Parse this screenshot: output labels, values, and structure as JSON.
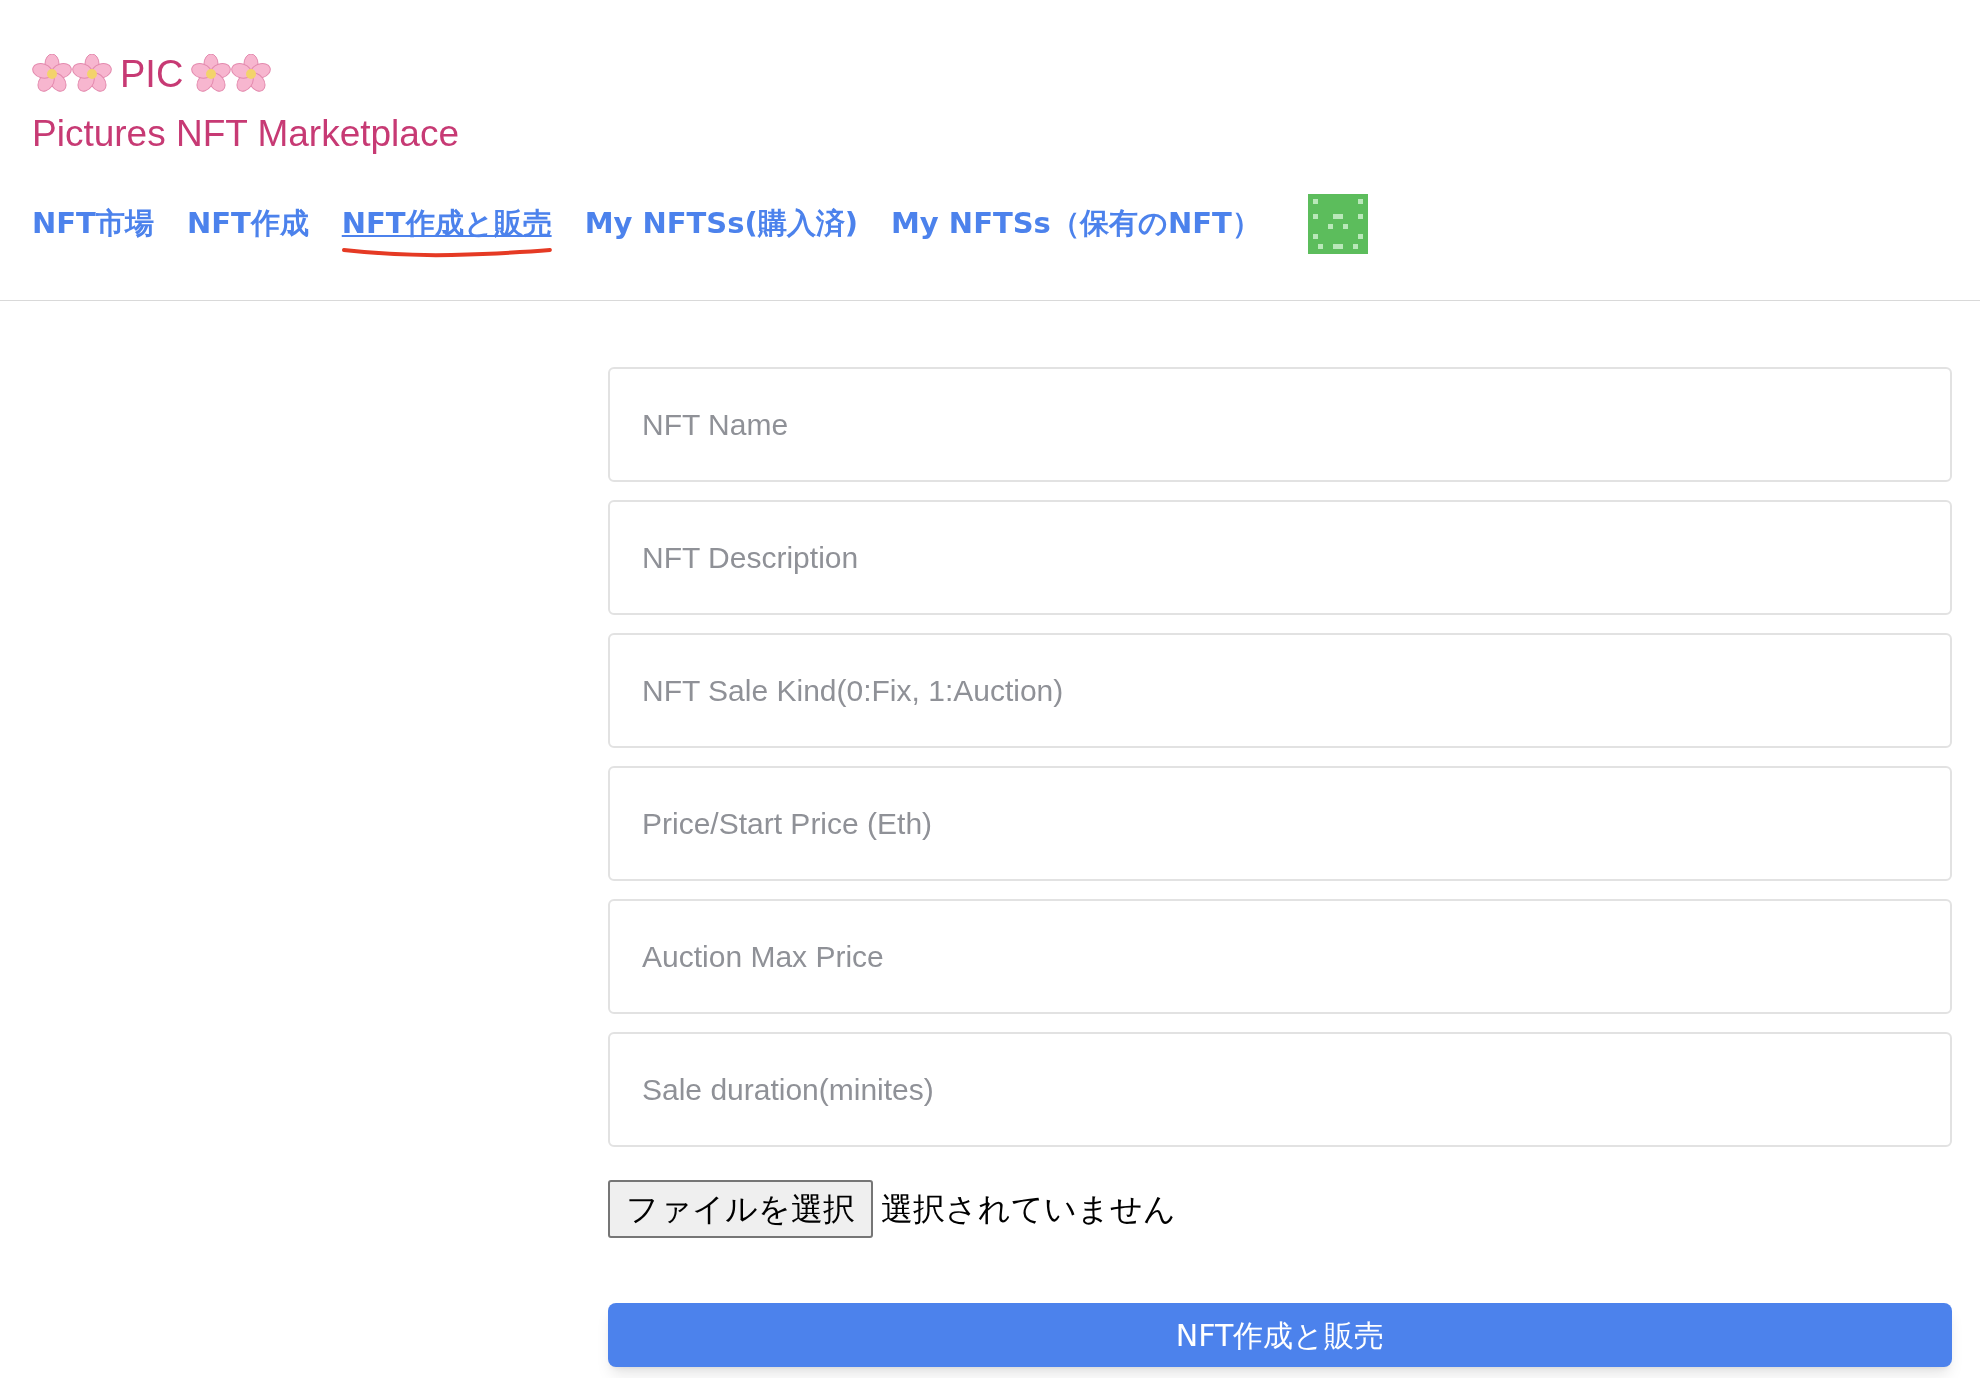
{
  "header": {
    "title": "PIC",
    "subtitle": "Pictures NFT Marketplace"
  },
  "nav": [
    {
      "label": "NFT市場",
      "selected": false
    },
    {
      "label": "NFT作成",
      "selected": false
    },
    {
      "label": "NFT作成と販売",
      "selected": true
    },
    {
      "label": "My NFTSs(購入済)",
      "selected": false
    },
    {
      "label": "My NFTSs（保有のNFT）",
      "selected": false
    }
  ],
  "form": {
    "fields": [
      {
        "placeholder": "NFT Name"
      },
      {
        "placeholder": "NFT Description"
      },
      {
        "placeholder": "NFT Sale Kind(0:Fix, 1:Auction)"
      },
      {
        "placeholder": "Price/Start Price (Eth)"
      },
      {
        "placeholder": "Auction Max Price"
      },
      {
        "placeholder": "Sale duration(minites)"
      }
    ],
    "file_button": "ファイルを選択",
    "file_status": "選択されていません",
    "submit": "NFT作成と販売"
  }
}
